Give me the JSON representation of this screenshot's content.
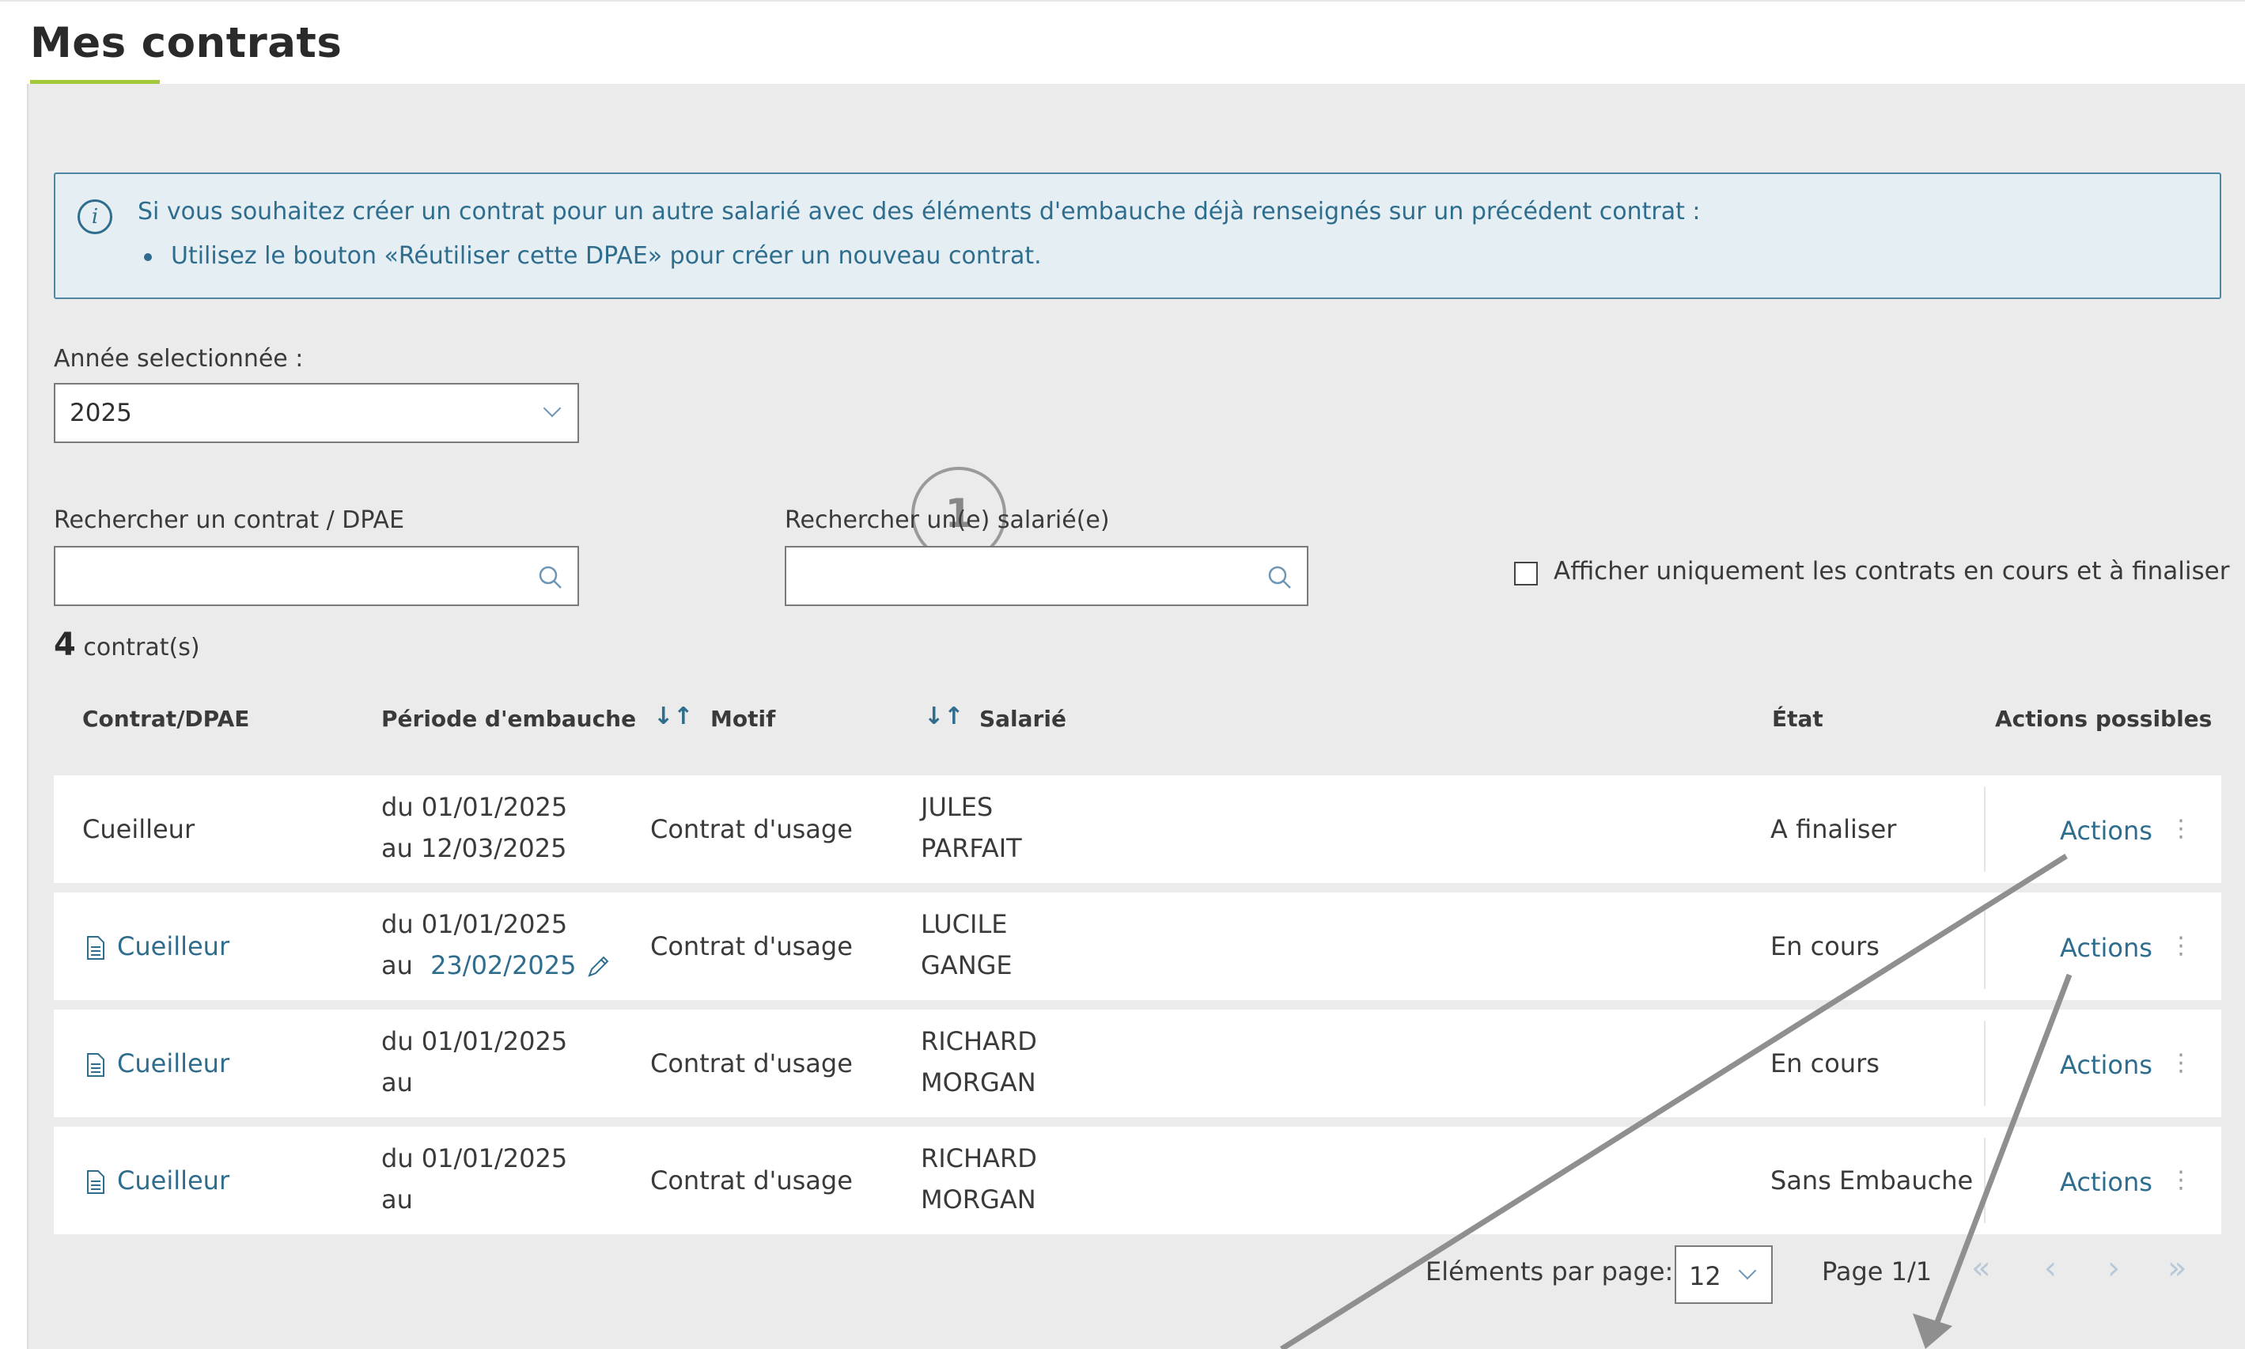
{
  "header": {
    "title": "Mes contrats"
  },
  "info": {
    "text": "Si vous souhaitez créer un contrat pour un autre salarié avec des éléments d'embauche déjà renseignés sur un précédent contrat :",
    "bullet": "Utilisez le bouton «Réutiliser cette DPAE» pour créer un nouveau contrat."
  },
  "year_filter": {
    "label": "Année selectionnée :",
    "value": "2025"
  },
  "callout_number": "1",
  "search_contract": {
    "label": "Rechercher un contrat / DPAE",
    "value": ""
  },
  "search_employee": {
    "label": "Rechercher un(e) salarié(e)",
    "value": ""
  },
  "filter_checkbox": {
    "label": "Afficher uniquement les contrats en cours et à finaliser",
    "checked": false
  },
  "count": {
    "number": "4",
    "suffix": "contrat(s)"
  },
  "table": {
    "headers": {
      "contrat": "Contrat/DPAE",
      "periode": "Période d'embauche",
      "motif": "Motif",
      "salarie": "Salarié",
      "etat": "État",
      "actions": "Actions possibles"
    },
    "sort_icon": "↓↑",
    "rows": [
      {
        "contrat": "Cueilleur",
        "link": false,
        "period_from": "du 01/01/2025",
        "period_to_prefix": "au",
        "period_to": "12/03/2025",
        "editable_date": false,
        "motif": "Contrat d'usage",
        "first_name": "JULES",
        "last_name": "PARFAIT",
        "etat": "A finaliser",
        "actions": "Actions"
      },
      {
        "contrat": "Cueilleur",
        "link": true,
        "period_from": "du 01/01/2025",
        "period_to_prefix": "au",
        "period_to": "23/02/2025",
        "editable_date": true,
        "motif": "Contrat d'usage",
        "first_name": "LUCILE",
        "last_name": "GANGE",
        "etat": "En cours",
        "actions": "Actions"
      },
      {
        "contrat": "Cueilleur",
        "link": true,
        "period_from": "du 01/01/2025",
        "period_to_prefix": "au",
        "period_to": "",
        "editable_date": false,
        "motif": "Contrat d'usage",
        "first_name": "RICHARD",
        "last_name": "MORGAN",
        "etat": "En cours",
        "actions": "Actions"
      },
      {
        "contrat": "Cueilleur",
        "link": true,
        "period_from": "du 01/01/2025",
        "period_to_prefix": "au",
        "period_to": "",
        "editable_date": false,
        "motif": "Contrat d'usage",
        "first_name": "RICHARD",
        "last_name": "MORGAN",
        "etat": "Sans Embauche",
        "actions": "Actions"
      }
    ]
  },
  "pagination": {
    "per_page_label": "Eléments par page:",
    "per_page_value": "12",
    "page_info": "Page 1/1",
    "first": "«",
    "prev": "‹",
    "next": "›",
    "last": "»"
  },
  "colors": {
    "accent": "#a3c93a",
    "link": "#2e6d8e",
    "info_border": "#4f86a1",
    "info_bg": "#e5eef2",
    "background": "#ebebeb"
  },
  "icons": [
    "info-icon",
    "chevron-down-icon",
    "search-icon",
    "sort-icon",
    "document-icon",
    "pencil-icon",
    "kebab-icon"
  ]
}
